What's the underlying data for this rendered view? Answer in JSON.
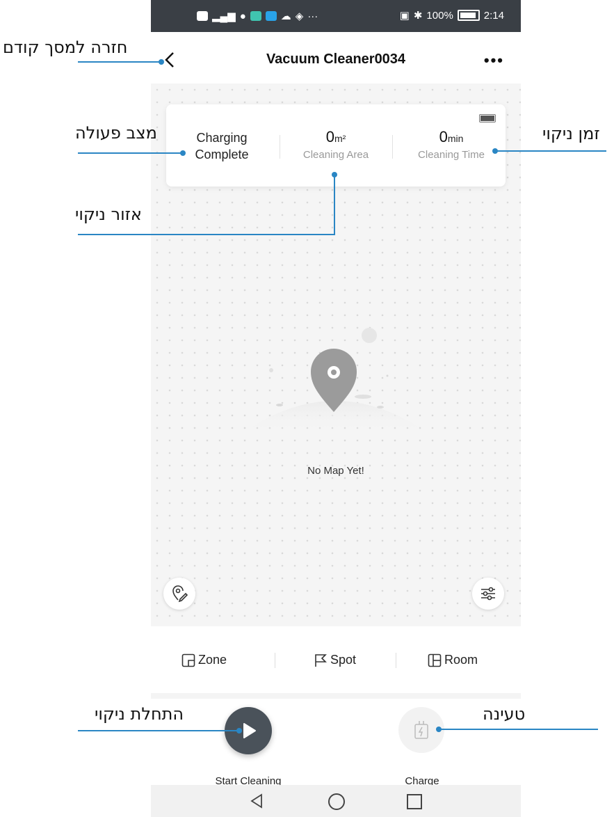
{
  "status_bar": {
    "battery": "100%",
    "time": "2:14"
  },
  "header": {
    "title": "Vacuum Cleaner0034",
    "more": "•••"
  },
  "status_card": {
    "mode_line1": "Charging",
    "mode_line2": "Complete",
    "area_value": "0",
    "area_unit": "m²",
    "area_label": "Cleaning Area",
    "time_value": "0",
    "time_unit": "min",
    "time_label": "Cleaning Time"
  },
  "map": {
    "empty_text": "No Map Yet!"
  },
  "tabs": [
    {
      "label": "Zone",
      "icon": "zone-icon"
    },
    {
      "label": "Spot",
      "icon": "flag-icon"
    },
    {
      "label": "Room",
      "icon": "room-icon"
    }
  ],
  "actions": {
    "start_label": "Start Cleaning",
    "charge_label": "Charge"
  },
  "annotations": {
    "back": "חזרה למסך קודם",
    "mode": "מצב פעולה",
    "time": "זמן ניקוי",
    "area": "אזור ניקוי",
    "start": "התחלת ניקוי",
    "charge": "טעינה"
  },
  "colors": {
    "accent_line": "#2a86c4",
    "status_bar": "#3a3f45",
    "start_button": "#4a525a"
  }
}
